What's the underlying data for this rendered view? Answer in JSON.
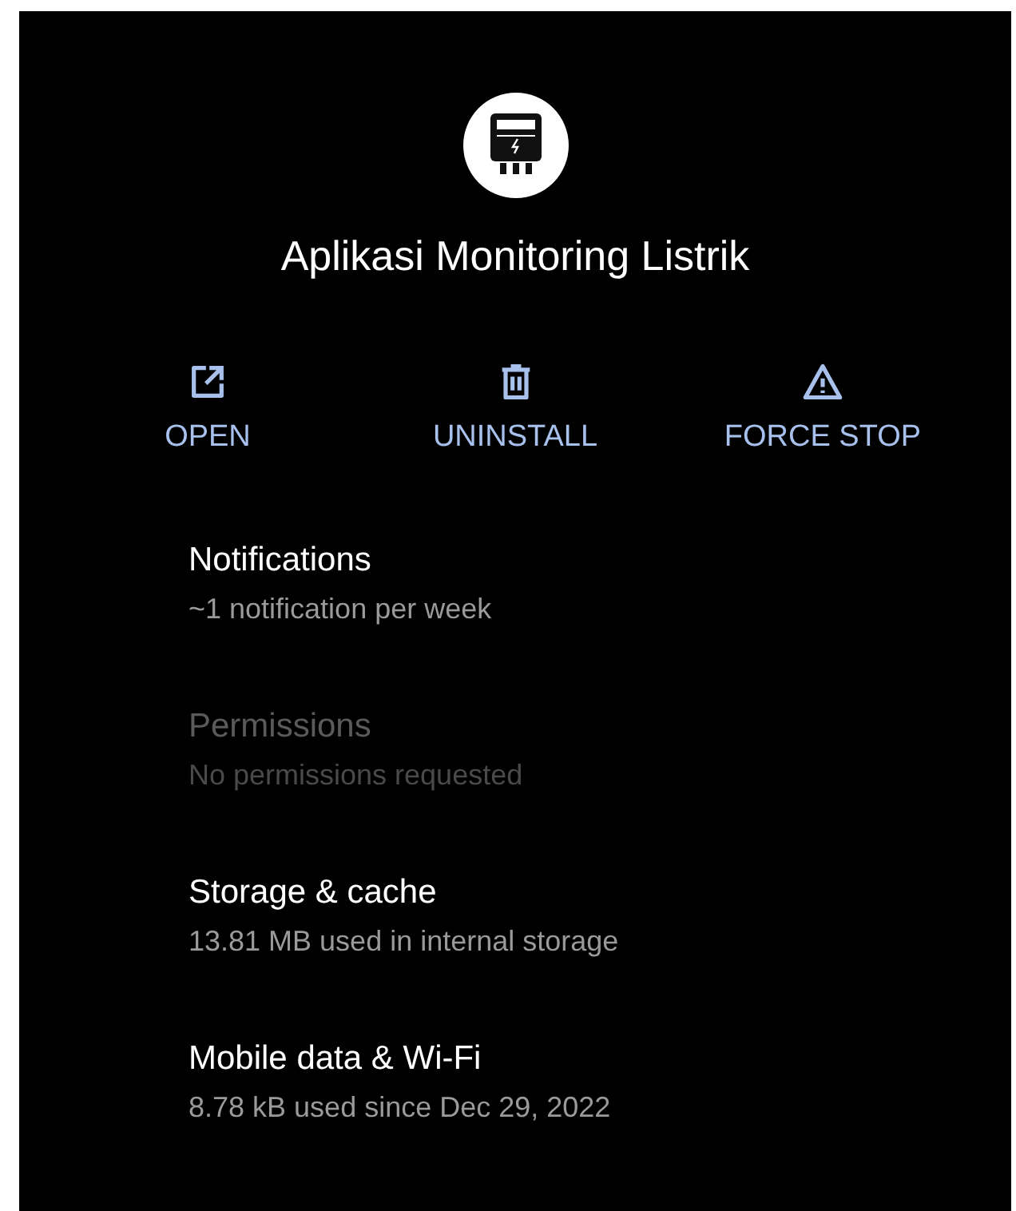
{
  "app": {
    "name": "Aplikasi Monitoring Listrik"
  },
  "actions": [
    {
      "kind": "open",
      "label": "OPEN"
    },
    {
      "kind": "delete",
      "label": "UNINSTALL"
    },
    {
      "kind": "warning",
      "label": "FORCE STOP"
    }
  ],
  "settings": [
    {
      "title": "Notifications",
      "summary": "~1 notification per week",
      "disabled": false
    },
    {
      "title": "Permissions",
      "summary": "No permissions requested",
      "disabled": true
    },
    {
      "title": "Storage & cache",
      "summary": "13.81 MB used in internal storage",
      "disabled": false
    },
    {
      "title": "Mobile data & Wi-Fi",
      "summary": "8.78 kB used since Dec 29, 2022",
      "disabled": false
    }
  ]
}
